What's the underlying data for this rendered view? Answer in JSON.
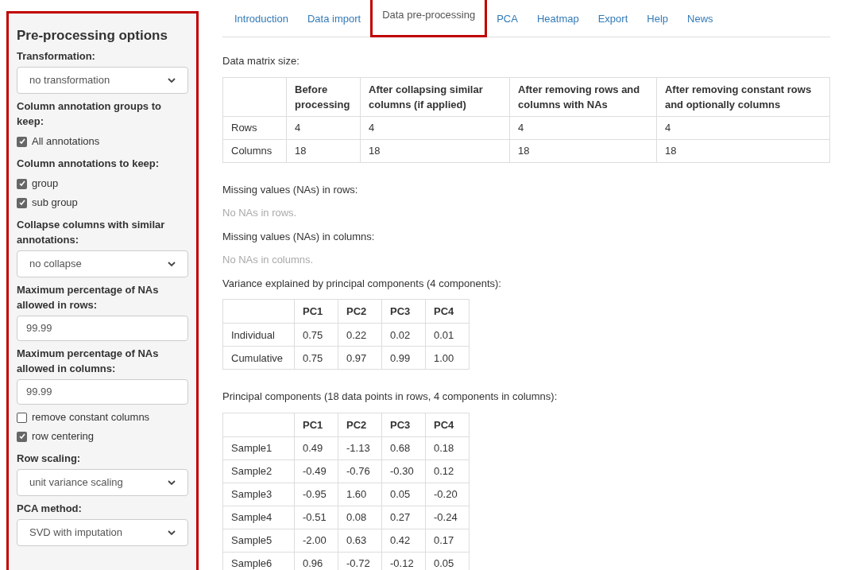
{
  "sidebar": {
    "title": "Pre-processing options",
    "items": [
      {
        "kind": "label",
        "text": "Transformation:"
      },
      {
        "kind": "select",
        "value": "no transformation"
      },
      {
        "kind": "label",
        "text": "Column annotation groups to keep:"
      },
      {
        "kind": "checkbox",
        "text": "All annotations",
        "checked": true
      },
      {
        "kind": "label",
        "text": "Column annotations to keep:"
      },
      {
        "kind": "checkbox",
        "text": "group",
        "checked": true
      },
      {
        "kind": "checkbox",
        "text": "sub group",
        "checked": true
      },
      {
        "kind": "label",
        "text": "Collapse columns with similar annotations:"
      },
      {
        "kind": "select",
        "value": "no collapse"
      },
      {
        "kind": "label",
        "text": "Maximum percentage of NAs allowed in rows:"
      },
      {
        "kind": "input",
        "value": "99.99"
      },
      {
        "kind": "label",
        "text": "Maximum percentage of NAs allowed in columns:"
      },
      {
        "kind": "input",
        "value": "99.99"
      },
      {
        "kind": "checkbox",
        "text": "remove constant columns",
        "checked": false
      },
      {
        "kind": "checkbox",
        "text": "row centering",
        "checked": true
      },
      {
        "kind": "label",
        "text": "Row scaling:"
      },
      {
        "kind": "select",
        "value": "unit variance scaling"
      },
      {
        "kind": "label",
        "text": "PCA method:"
      },
      {
        "kind": "select",
        "value": "SVD with imputation"
      }
    ]
  },
  "tabs": [
    {
      "label": "Introduction",
      "selected": false
    },
    {
      "label": "Data import",
      "selected": false
    },
    {
      "label": "Data pre-processing",
      "selected": true
    },
    {
      "label": "PCA",
      "selected": false
    },
    {
      "label": "Heatmap",
      "selected": false
    },
    {
      "label": "Export",
      "selected": false
    },
    {
      "label": "Help",
      "selected": false
    },
    {
      "label": "News",
      "selected": false
    }
  ],
  "sections": [
    {
      "kind": "table",
      "caption": "Data matrix size:",
      "columns": [
        "",
        "Before processing",
        "After collapsing similar columns (if applied)",
        "After removing rows and columns with NAs",
        "After removing constant rows and optionally columns"
      ],
      "rows": [
        [
          "Rows",
          "4",
          "4",
          "4",
          "4"
        ],
        [
          "Columns",
          "18",
          "18",
          "18",
          "18"
        ]
      ]
    },
    {
      "kind": "note",
      "caption": "Missing values (NAs) in rows:",
      "text": "No NAs in rows."
    },
    {
      "kind": "note",
      "caption": "Missing values (NAs) in columns:",
      "text": "No NAs in columns."
    },
    {
      "kind": "table",
      "caption": "Variance explained by principal components (4 components):",
      "columns": [
        "",
        "PC1",
        "PC2",
        "PC3",
        "PC4"
      ],
      "rows": [
        [
          "Individual",
          "0.75",
          "0.22",
          "0.02",
          "0.01"
        ],
        [
          "Cumulative",
          "0.75",
          "0.97",
          "0.99",
          "1.00"
        ]
      ]
    },
    {
      "kind": "table",
      "caption": "Principal components (18 data points in rows, 4 components in columns):",
      "columns": [
        "",
        "PC1",
        "PC2",
        "PC3",
        "PC4"
      ],
      "rows": [
        [
          "Sample1",
          "0.49",
          "-1.13",
          "0.68",
          "0.18"
        ],
        [
          "Sample2",
          "-0.49",
          "-0.76",
          "-0.30",
          "0.12"
        ],
        [
          "Sample3",
          "-0.95",
          "1.60",
          "0.05",
          "-0.20"
        ],
        [
          "Sample4",
          "-0.51",
          "0.08",
          "0.27",
          "-0.24"
        ],
        [
          "Sample5",
          "-2.00",
          "0.63",
          "0.42",
          "0.17"
        ],
        [
          "Sample6",
          "0.96",
          "-0.72",
          "-0.12",
          "0.05"
        ]
      ]
    }
  ]
}
